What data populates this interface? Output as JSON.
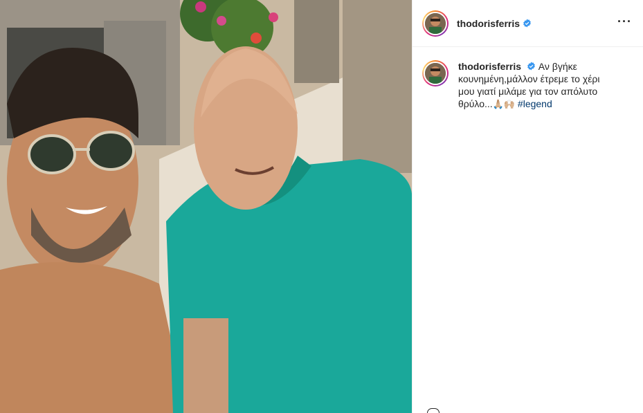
{
  "post": {
    "username": "thodorisferris",
    "verified": true,
    "more_icon": "more-options-icon",
    "photo_alt": "selfie photo"
  },
  "caption": {
    "username": "thodorisferris",
    "text": "Αν βγήκε κουνημένη,μάλλον έτρεμε το χέρι μου γιατί μιλάμε για τον απόλυτο θρύλο...",
    "emojis": "🙏🏼🙌🏼",
    "hashtag": "#legend"
  },
  "colors": {
    "verified": "#3897f0",
    "hashtag": "#00376b",
    "shirt": "#1aa89a"
  }
}
